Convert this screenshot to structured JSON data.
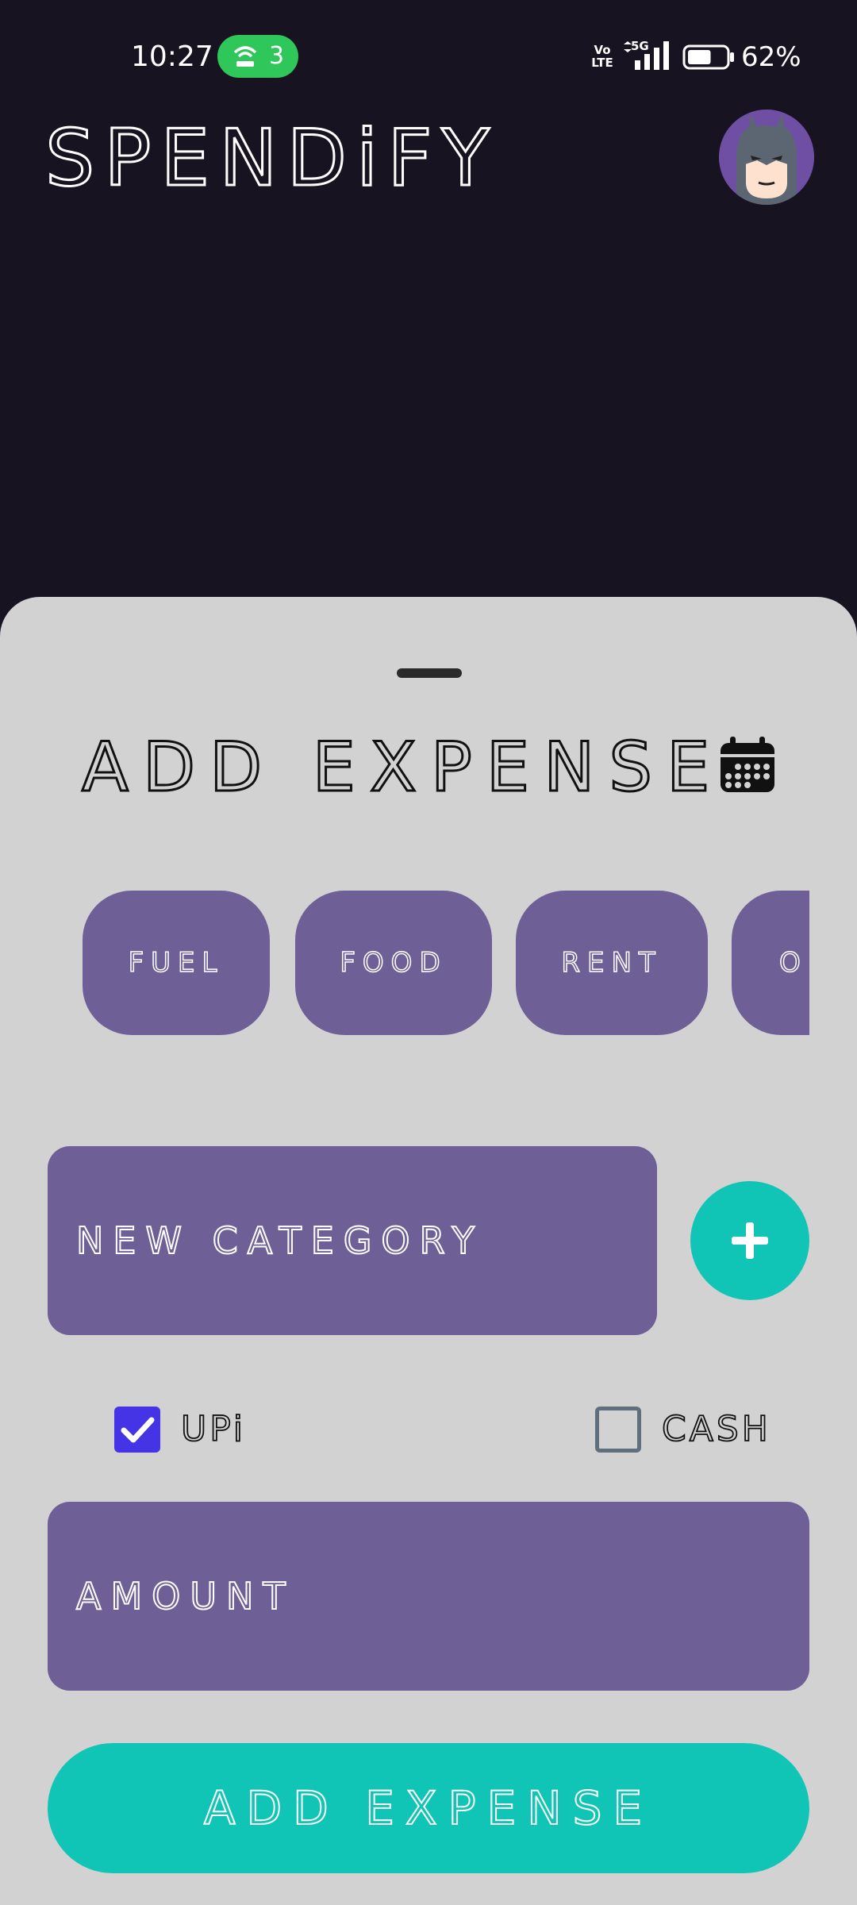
{
  "status_bar": {
    "time": "10:27",
    "hotspot_count": "3",
    "volte": "Vo LTE",
    "network": "5G",
    "battery_percent": "62%",
    "battery_level": 0.62
  },
  "header": {
    "app_title": "SPENDiFY",
    "avatar_icon": "batman-avatar-icon"
  },
  "sheet": {
    "title": "ADD EXPENSE",
    "calendar_icon": "calendar-icon",
    "categories": [
      "FUEL",
      "FOOD",
      "RENT",
      "O"
    ],
    "new_category_placeholder": "NEW CATEGORY",
    "add_category_icon": "plus-icon",
    "payment_methods": [
      {
        "label": "UPi",
        "checked": true
      },
      {
        "label": "CASH",
        "checked": false
      }
    ],
    "amount_placeholder": "AMOUNT",
    "submit_label": "ADD EXPENSE"
  },
  "colors": {
    "background": "#171321",
    "sheet": "#d2d2d2",
    "field": "#6e6097",
    "accent": "#10c5b5",
    "checkbox": "#4534e6"
  }
}
